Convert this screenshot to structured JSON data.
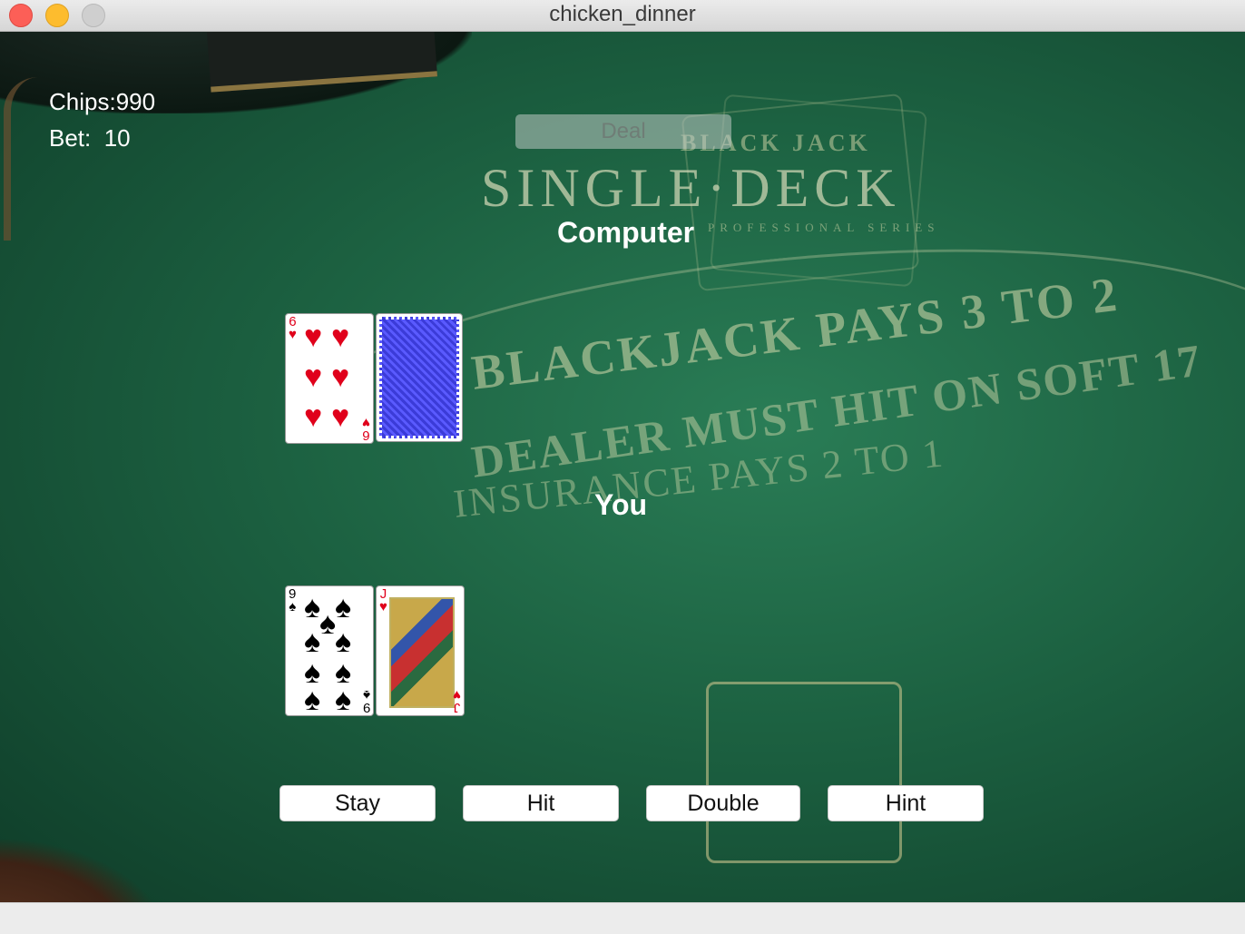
{
  "window": {
    "title": "chicken_dinner"
  },
  "hud": {
    "chips_label": "Chips:",
    "chips_value": "990",
    "bet_label": "Bet:",
    "bet_value": "10"
  },
  "controls": {
    "deal": "Deal",
    "stay": "Stay",
    "hit": "Hit",
    "double": "Double",
    "hint": "Hint"
  },
  "labels": {
    "computer": "Computer",
    "player": "You"
  },
  "felt": {
    "blackjack": "BLACK JACK",
    "single_deck": "SINGLE·DECK",
    "series": "PROFESSIONAL SERIES",
    "pays": "BLACKJACK PAYS 3 TO 2",
    "dealer_rule": "DEALER MUST HIT ON SOFT 17",
    "insurance": "INSURANCE PAYS 2 TO 1"
  },
  "computer_hand": [
    {
      "rank": "6",
      "suit": "hearts",
      "symbol": "♥",
      "color": "#e0001b",
      "face_up": true
    },
    {
      "face_up": false,
      "back_color": "#3b3bd8"
    }
  ],
  "player_hand": [
    {
      "rank": "9",
      "suit": "spades",
      "symbol": "♠",
      "color": "#000000",
      "face_up": true
    },
    {
      "rank": "J",
      "suit": "hearts",
      "symbol": "♥",
      "color": "#e0001b",
      "face_up": true
    }
  ]
}
